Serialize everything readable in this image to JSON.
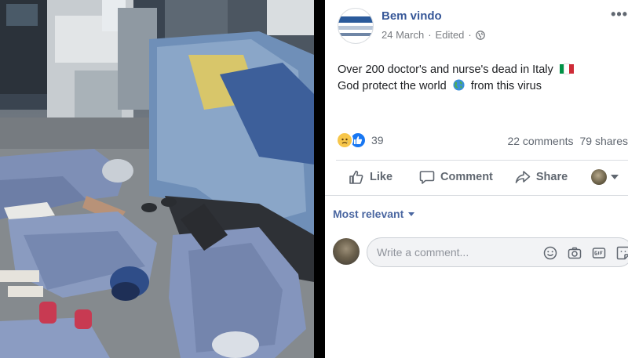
{
  "post": {
    "page_name": "Bem vindo",
    "date": "24 March",
    "edited": "Edited",
    "text_line1": "Over 200 doctor's and nurse's dead in Italy",
    "text_line2_before": "God protect the world",
    "text_line2_after": "from this virus",
    "reaction_count": "39",
    "comments": "22 comments",
    "shares": "79 shares"
  },
  "actions": {
    "like": "Like",
    "comment": "Comment",
    "share": "Share"
  },
  "comments_section": {
    "sort_label": "Most relevant",
    "placeholder": "Write a comment..."
  },
  "icons": {
    "privacy": "globe-icon",
    "flag": "italy-flag-icon",
    "earth": "earth-emoji-icon",
    "reactions": [
      "sad-reaction-icon",
      "like-reaction-icon"
    ],
    "comment_tools": [
      "emoji-icon",
      "camera-icon",
      "gif-icon",
      "sticker-icon"
    ]
  },
  "colors": {
    "facebook_blue": "#385898",
    "link_blue": "#4b67a1",
    "like_blue": "#1877f2",
    "text_dark": "#1c1e21",
    "text_grey": "#606770",
    "flag_green": "#009246",
    "flag_white": "#ffffff",
    "flag_red": "#ce2b37"
  }
}
